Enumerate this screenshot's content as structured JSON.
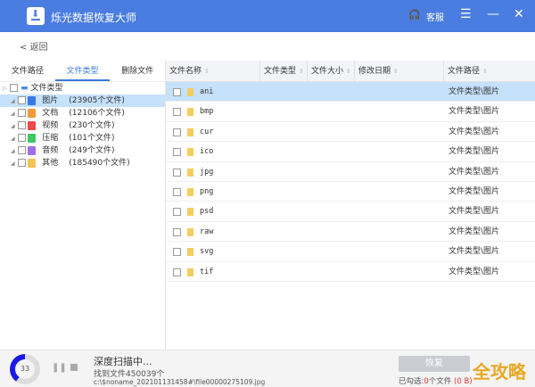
{
  "app": {
    "title": "烁光数据恢复大师",
    "service": "客服",
    "back": "返回"
  },
  "left": {
    "tabs": [
      "文件路径",
      "文件类型",
      "删除文件"
    ],
    "root": "文件类型",
    "items": [
      {
        "name": "图片",
        "count": "(23905个文件)",
        "color": "#3b78e7"
      },
      {
        "name": "文档",
        "count": "(12106个文件)",
        "color": "#f29a3a"
      },
      {
        "name": "视频",
        "count": "(230个文件)",
        "color": "#ee4b4b"
      },
      {
        "name": "压缩",
        "count": "(101个文件)",
        "color": "#3cc863"
      },
      {
        "name": "音频",
        "count": "(249个文件)",
        "color": "#a26ee8"
      },
      {
        "name": "其他",
        "count": "(185490个文件)",
        "color": "#f5c255"
      }
    ]
  },
  "table": {
    "headers": [
      "文件名称",
      "文件类型",
      "文件大小",
      "修改日期",
      "文件路径"
    ],
    "rows": [
      {
        "name": "ani",
        "path": "文件类型\\图片"
      },
      {
        "name": "bmp",
        "path": "文件类型\\图片"
      },
      {
        "name": "cur",
        "path": "文件类型\\图片"
      },
      {
        "name": "ico",
        "path": "文件类型\\图片"
      },
      {
        "name": "jpg",
        "path": "文件类型\\图片"
      },
      {
        "name": "png",
        "path": "文件类型\\图片"
      },
      {
        "name": "psd",
        "path": "文件类型\\图片"
      },
      {
        "name": "raw",
        "path": "文件类型\\图片"
      },
      {
        "name": "svg",
        "path": "文件类型\\图片"
      },
      {
        "name": "tif",
        "path": "文件类型\\图片"
      }
    ]
  },
  "status": {
    "progress": "33",
    "title": "深度扫描中...",
    "found": "找到文件450039个",
    "current": "c:\\$noname_20210113145​8#\\file00000275109.jpg",
    "restore": "恢复",
    "selected_prefix": "已勾选:",
    "selected_count": "0",
    "selected_suffix": "个文件",
    "selected_size": "(0 B)"
  },
  "watermark": "全攻略"
}
